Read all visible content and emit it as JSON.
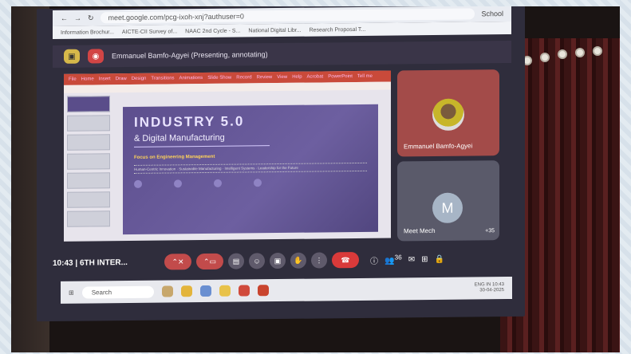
{
  "browser": {
    "url": "meet.google.com/pcg-ixoh-xnj?authuser=0",
    "bookmarks": [
      "Information Brochur...",
      "AICTE-CII Survey of...",
      "NAAC 2nd Cycle - S...",
      "National Digital Libr...",
      "Research Proposal T..."
    ],
    "profile": "School"
  },
  "meet": {
    "presenter_label": "Emmanuel Bamfo-Agyei (Presenting, annotating)"
  },
  "powerpoint": {
    "menu": [
      "File",
      "Home",
      "Insert",
      "Draw",
      "Design",
      "Transitions",
      "Animations",
      "Slide Show",
      "Record",
      "Review",
      "View",
      "Help",
      "Acrobat",
      "PowerPoint",
      "Tell me"
    ]
  },
  "slide": {
    "title": "INDUSTRY 5.0",
    "subtitle": "& Digital Manufacturing",
    "focus": "Focus on Engineering Management",
    "tags": "Human-Centric Innovation · Sustainable Manufacturing · Intelligent Systems · Leadership for the Future"
  },
  "participants": [
    {
      "name": "Emmanuel Bamfo-Agyei"
    },
    {
      "name": "Meet Mech",
      "initial": "M",
      "extra": "+35"
    }
  ],
  "controls": {
    "time": "10:43",
    "meeting": "6TH INTER...",
    "people_count": "36"
  },
  "taskbar": {
    "search": "Search",
    "lang": "ENG IN",
    "clock": "10:43",
    "date": "30-04-2025"
  }
}
